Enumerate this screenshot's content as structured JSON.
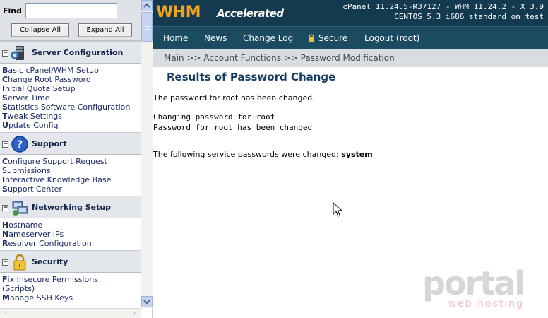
{
  "left_panel": {
    "find_label": "Find",
    "find_value": "",
    "collapse_label": "Collapse All",
    "expand_label": "Expand All",
    "sections": [
      {
        "title": "Server Configuration",
        "icon": "server-icon",
        "links": [
          {
            "first": "B",
            "rest": "asic cPanel/WHM Setup"
          },
          {
            "first": "C",
            "rest": "hange Root Password"
          },
          {
            "first": "I",
            "rest": "nitial Quota Setup"
          },
          {
            "first": "S",
            "rest": "erver Time"
          },
          {
            "first": "S",
            "rest": "tatistics Software Configuration"
          },
          {
            "first": "T",
            "rest": "weak Settings"
          },
          {
            "first": "U",
            "rest": "pdate Config"
          }
        ]
      },
      {
        "title": "Support",
        "icon": "help-icon",
        "links": [
          {
            "first": "C",
            "rest": "onfigure Support Request"
          },
          {
            "first": "",
            "rest": "Submissions"
          },
          {
            "first": "I",
            "rest": "nteractive Knowledge Base"
          },
          {
            "first": "S",
            "rest": "upport Center"
          }
        ]
      },
      {
        "title": "Networking Setup",
        "icon": "network-icon",
        "links": [
          {
            "first": "H",
            "rest": "ostname"
          },
          {
            "first": "N",
            "rest": "ameserver IPs"
          },
          {
            "first": "R",
            "rest": "esolver Configuration"
          }
        ]
      },
      {
        "title": "Security",
        "icon": "lock-icon",
        "links": [
          {
            "first": "F",
            "rest": "ix Insecure Permissions"
          },
          {
            "first": "",
            "rest": "(Scripts)"
          },
          {
            "first": "M",
            "rest": "anage SSH Keys"
          }
        ]
      }
    ]
  },
  "header": {
    "logo": "WHM",
    "logo_sub": "Accelerated",
    "version_line1": "cPanel 11.24.5-R37127 - WHM 11.24.2 - X 3.9",
    "version_line2": "CENTOS 5.3 i686 standard on test"
  },
  "nav": {
    "home": "Home",
    "news": "News",
    "changelog": "Change Log",
    "secure": "Secure",
    "logout": "Logout (root)"
  },
  "breadcrumb": "Main >> Account Functions >> Password Modification",
  "main": {
    "title": "Results of Password Change",
    "changed_msg": "The password for root has been changed.",
    "output": "Changing password for root\nPassword for root has been changed",
    "services_prefix": "The following service passwords were changed: ",
    "services_value": "system",
    "services_suffix": "."
  },
  "watermark": {
    "brand": "portal",
    "tagline": "web hosting"
  },
  "colors": {
    "banner": "#143a50",
    "nav": "#1b4b61",
    "logo_accent": "#f2a11a",
    "title": "#173d63",
    "link": "#1c2a66"
  }
}
